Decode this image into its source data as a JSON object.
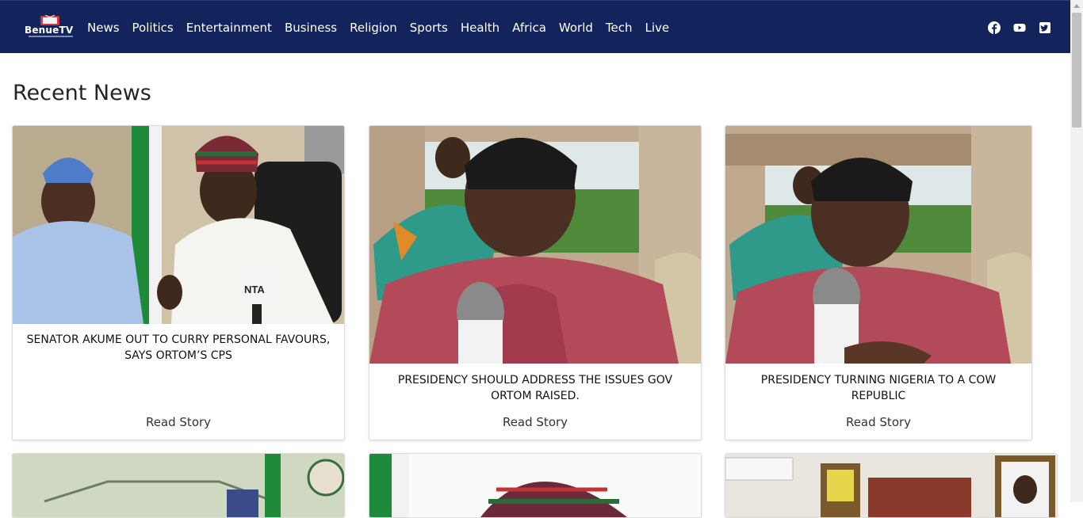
{
  "brand": {
    "name": "BenueTV"
  },
  "nav": {
    "links": [
      "News",
      "Politics",
      "Entertainment",
      "Business",
      "Religion",
      "Sports",
      "Health",
      "Africa",
      "World",
      "Tech",
      "Live"
    ]
  },
  "social": {
    "icons": [
      "facebook-icon",
      "youtube-icon",
      "twitter-icon"
    ]
  },
  "colors": {
    "navbar": "#13235b",
    "text": "#212529"
  },
  "main": {
    "heading": "Recent News",
    "cards": [
      {
        "title": "SENATOR AKUME OUT TO CURRY PERSONAL FAVOURS, SAYS ORTOM’S CPS",
        "link": "Read Story"
      },
      {
        "title": "PRESIDENCY SHOULD ADDRESS THE ISSUES GOV ORTOM RAISED.",
        "link": "Read Story"
      },
      {
        "title": "PRESIDENCY TURNING NIGERIA TO A COW REPUBLIC",
        "link": "Read Story"
      }
    ]
  }
}
